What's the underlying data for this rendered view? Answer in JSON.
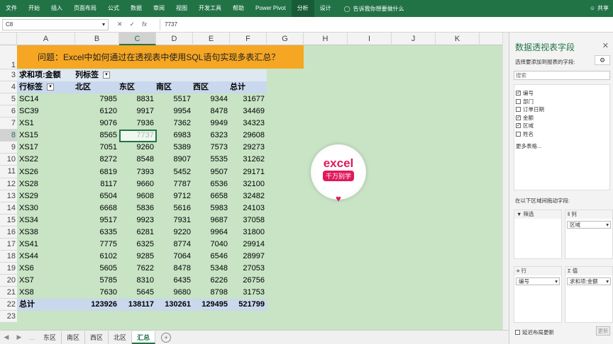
{
  "ribbon": {
    "tabs": [
      "文件",
      "开始",
      "插入",
      "页面布局",
      "公式",
      "数据",
      "审阅",
      "视图",
      "开发工具",
      "帮助",
      "Power Pivot",
      "分析",
      "设计"
    ],
    "tellme": "告诉我你想要做什么",
    "share": "共享"
  },
  "formula": {
    "namebox": "C8",
    "value": "7737"
  },
  "columns": [
    "A",
    "B",
    "C",
    "D",
    "E",
    "F",
    "G",
    "H",
    "I",
    "J",
    "K"
  ],
  "rows": [
    "1",
    "2",
    "3",
    "4",
    "5",
    "6",
    "7",
    "8",
    "9",
    "10",
    "11",
    "12",
    "13",
    "14",
    "15",
    "16",
    "17",
    "18",
    "19",
    "20",
    "21",
    "22",
    "23"
  ],
  "title": "问题：Excel中如何通过在透视表中使用SQL语句实现多表汇总？",
  "pivot": {
    "value_label": "求和项:金额",
    "col_label": "列标签",
    "row_label": "行标签",
    "headers": [
      "北区",
      "东区",
      "南区",
      "西区",
      "总计"
    ],
    "rows": [
      [
        "SC14",
        "7985",
        "8831",
        "5517",
        "9344",
        "31677"
      ],
      [
        "SC39",
        "6120",
        "9917",
        "9954",
        "8478",
        "34469"
      ],
      [
        "XS1",
        "9076",
        "7936",
        "7362",
        "9949",
        "34323"
      ],
      [
        "XS15",
        "8565",
        "7737",
        "6983",
        "6323",
        "29608"
      ],
      [
        "XS17",
        "7051",
        "9260",
        "5389",
        "7573",
        "29273"
      ],
      [
        "XS22",
        "8272",
        "8548",
        "8907",
        "5535",
        "31262"
      ],
      [
        "XS26",
        "6819",
        "7393",
        "5452",
        "9507",
        "29171"
      ],
      [
        "XS28",
        "8117",
        "9660",
        "7787",
        "6536",
        "32100"
      ],
      [
        "XS29",
        "6504",
        "9608",
        "9712",
        "6658",
        "32482"
      ],
      [
        "XS30",
        "6668",
        "5836",
        "5616",
        "5983",
        "24103"
      ],
      [
        "XS34",
        "9517",
        "9923",
        "7931",
        "9687",
        "37058"
      ],
      [
        "XS38",
        "6335",
        "6281",
        "9220",
        "9964",
        "31800"
      ],
      [
        "XS41",
        "7775",
        "6325",
        "8774",
        "7040",
        "29914"
      ],
      [
        "XS44",
        "6102",
        "9285",
        "7064",
        "6546",
        "28997"
      ],
      [
        "XS6",
        "5605",
        "7622",
        "8478",
        "5348",
        "27053"
      ],
      [
        "XS7",
        "5785",
        "8310",
        "6435",
        "6226",
        "26756"
      ],
      [
        "XS8",
        "7630",
        "5645",
        "9680",
        "8798",
        "31753"
      ]
    ],
    "total": [
      "总计",
      "123926",
      "138117",
      "130261",
      "129495",
      "521799"
    ]
  },
  "logo": {
    "line1": "excel",
    "line2": "千万别学"
  },
  "sheets": [
    "东区",
    "南区",
    "西区",
    "北区",
    "汇总"
  ],
  "pane": {
    "title": "数据透视表字段",
    "subtitle": "选择要添加到报表的字段:",
    "search": "搜索",
    "fields": [
      {
        "name": "编号",
        "checked": true
      },
      {
        "name": "部门",
        "checked": false
      },
      {
        "name": "订单日期",
        "checked": false
      },
      {
        "name": "金额",
        "checked": true
      },
      {
        "name": "区域",
        "checked": true
      },
      {
        "name": "姓名",
        "checked": false
      }
    ],
    "more": "更多表格...",
    "drag": "在以下区域间拖动字段:",
    "filter": "筛选",
    "columns": "列",
    "rows": "行",
    "values": "值",
    "col_chip": "区域",
    "row_chip": "编号",
    "val_chip": "求和项:金额",
    "defer": "延迟布局更新",
    "update": "更新"
  }
}
